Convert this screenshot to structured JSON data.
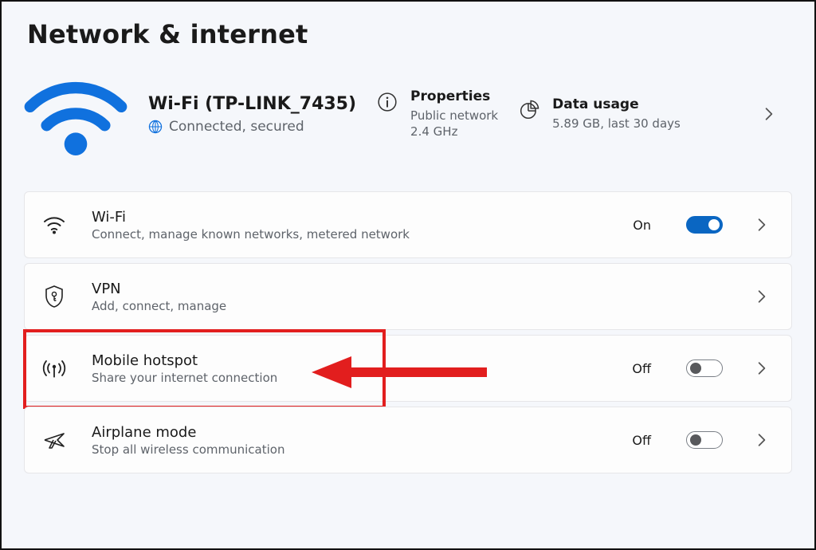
{
  "page_title": "Network & internet",
  "connection": {
    "name": "Wi-Fi (TP-LINK_7435)",
    "status": "Connected, secured"
  },
  "properties": {
    "label": "Properties",
    "line1": "Public network",
    "line2": "2.4 GHz"
  },
  "data_usage": {
    "label": "Data usage",
    "value": "5.89 GB, last 30 days"
  },
  "tiles": {
    "wifi": {
      "title": "Wi-Fi",
      "sub": "Connect, manage known networks, metered network",
      "state": "On"
    },
    "vpn": {
      "title": "VPN",
      "sub": "Add, connect, manage"
    },
    "hotspot": {
      "title": "Mobile hotspot",
      "sub": "Share your internet connection",
      "state": "Off"
    },
    "airplane": {
      "title": "Airplane mode",
      "sub": "Stop all wireless communication",
      "state": "Off"
    }
  },
  "annotation": {
    "highlight": "hotspot"
  }
}
